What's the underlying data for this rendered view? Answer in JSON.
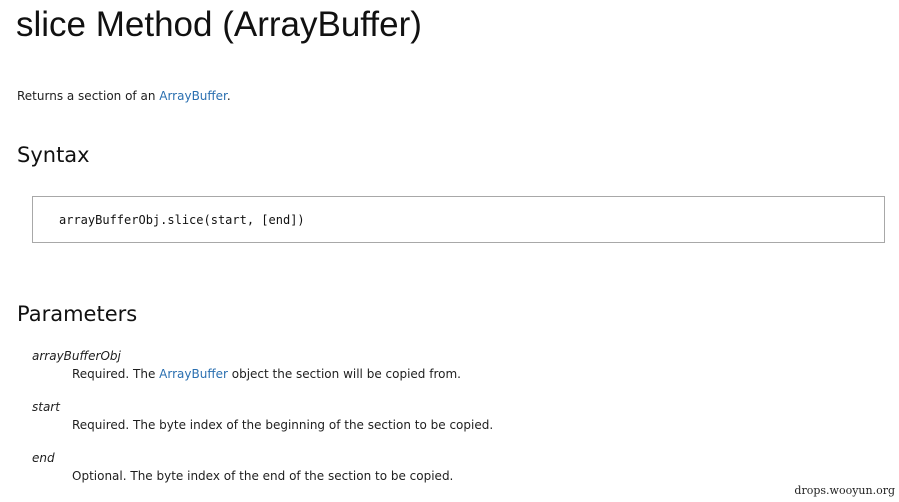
{
  "page": {
    "title": "slice Method (ArrayBuffer)",
    "summary": {
      "prefix": "Returns a section of an ",
      "link": "ArrayBuffer",
      "suffix": "."
    }
  },
  "syntax": {
    "heading": "Syntax",
    "code": "arrayBufferObj.slice(start, [end])"
  },
  "parameters": {
    "heading": "Parameters",
    "items": [
      {
        "name": "arrayBufferObj",
        "desc_prefix": "Required. The ",
        "desc_link": "ArrayBuffer",
        "desc_suffix": " object the section will be copied from."
      },
      {
        "name": "start",
        "desc": "Required. The byte index of the beginning of the section to be copied."
      },
      {
        "name": "end",
        "desc": "Optional. The byte index of the end of the section to be copied."
      }
    ]
  },
  "watermark": "drops.wooyun.org",
  "colors": {
    "link": "#2a6fb0",
    "text": "#111111",
    "code_border": "#a8a8a8"
  }
}
